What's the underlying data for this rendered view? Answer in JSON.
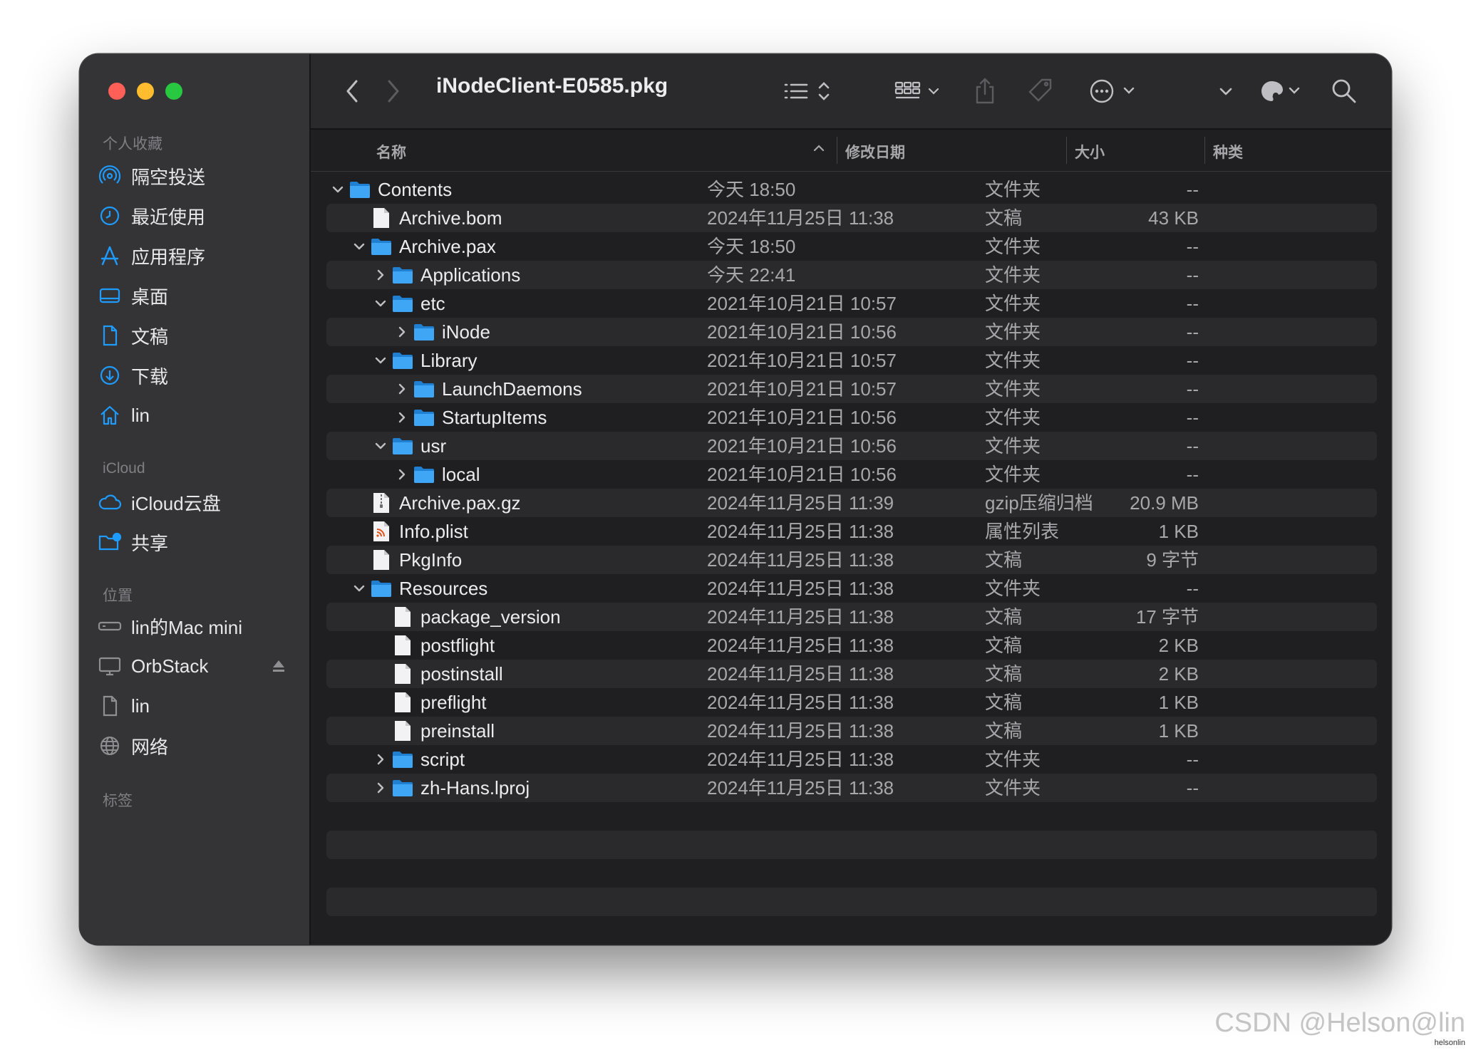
{
  "window": {
    "title": "iNodeClient-E0585.pkg"
  },
  "sidebar": {
    "sections": [
      {
        "heading": "个人收藏",
        "items": [
          {
            "label": "隔空投送",
            "icon": "airdrop-icon"
          },
          {
            "label": "最近使用",
            "icon": "clock-icon"
          },
          {
            "label": "应用程序",
            "icon": "applications-icon"
          },
          {
            "label": "桌面",
            "icon": "desktop-icon"
          },
          {
            "label": "文稿",
            "icon": "document-icon"
          },
          {
            "label": "下载",
            "icon": "download-icon"
          },
          {
            "label": "lin",
            "icon": "home-icon"
          }
        ]
      },
      {
        "heading": "iCloud",
        "items": [
          {
            "label": "iCloud云盘",
            "icon": "cloud-icon"
          },
          {
            "label": "共享",
            "icon": "shared-folder-icon"
          }
        ]
      },
      {
        "heading": "位置",
        "items": [
          {
            "label": "lin的Mac mini",
            "icon": "mac-mini-icon"
          },
          {
            "label": "OrbStack",
            "icon": "monitor-icon"
          },
          {
            "label": "lin",
            "icon": "document-icon"
          },
          {
            "label": "网络",
            "icon": "network-globe-icon"
          }
        ]
      },
      {
        "heading": "标签",
        "items": []
      }
    ]
  },
  "columns": {
    "name": "名称",
    "date": "修改日期",
    "size": "大小",
    "kind": "种类"
  },
  "files": [
    {
      "name": "Contents",
      "date": "今天 18:50",
      "size": "--",
      "kind": "文件夹",
      "level": 0,
      "type": "folder",
      "expanded": true
    },
    {
      "name": "Archive.bom",
      "date": "2024年11月25日 11:38",
      "size": "43 KB",
      "kind": "文稿",
      "level": 1,
      "type": "file"
    },
    {
      "name": "Archive.pax",
      "date": "今天 18:50",
      "size": "--",
      "kind": "文件夹",
      "level": 1,
      "type": "folder",
      "expanded": true
    },
    {
      "name": "Applications",
      "date": "今天 22:41",
      "size": "--",
      "kind": "文件夹",
      "level": 2,
      "type": "folder",
      "expanded": false
    },
    {
      "name": "etc",
      "date": "2021年10月21日 10:57",
      "size": "--",
      "kind": "文件夹",
      "level": 2,
      "type": "folder",
      "expanded": true
    },
    {
      "name": "iNode",
      "date": "2021年10月21日 10:56",
      "size": "--",
      "kind": "文件夹",
      "level": 3,
      "type": "folder",
      "expanded": false
    },
    {
      "name": "Library",
      "date": "2021年10月21日 10:57",
      "size": "--",
      "kind": "文件夹",
      "level": 2,
      "type": "folder",
      "expanded": true
    },
    {
      "name": "LaunchDaemons",
      "date": "2021年10月21日 10:57",
      "size": "--",
      "kind": "文件夹",
      "level": 3,
      "type": "folder",
      "expanded": false
    },
    {
      "name": "StartupItems",
      "date": "2021年10月21日 10:56",
      "size": "--",
      "kind": "文件夹",
      "level": 3,
      "type": "folder",
      "expanded": false
    },
    {
      "name": "usr",
      "date": "2021年10月21日 10:56",
      "size": "--",
      "kind": "文件夹",
      "level": 2,
      "type": "folder",
      "expanded": true
    },
    {
      "name": "local",
      "date": "2021年10月21日 10:56",
      "size": "--",
      "kind": "文件夹",
      "level": 3,
      "type": "folder",
      "expanded": false
    },
    {
      "name": "Archive.pax.gz",
      "date": "2024年11月25日 11:39",
      "size": "20.9 MB",
      "kind": "gzip压缩归档",
      "level": 1,
      "type": "archive"
    },
    {
      "name": "Info.plist",
      "date": "2024年11月25日 11:38",
      "size": "1 KB",
      "kind": "属性列表",
      "level": 1,
      "type": "plist"
    },
    {
      "name": "PkgInfo",
      "date": "2024年11月25日 11:38",
      "size": "9 字节",
      "kind": "文稿",
      "level": 1,
      "type": "file"
    },
    {
      "name": "Resources",
      "date": "2024年11月25日 11:38",
      "size": "--",
      "kind": "文件夹",
      "level": 1,
      "type": "folder",
      "expanded": true
    },
    {
      "name": "package_version",
      "date": "2024年11月25日 11:38",
      "size": "17 字节",
      "kind": "文稿",
      "level": 2,
      "type": "file"
    },
    {
      "name": "postflight",
      "date": "2024年11月25日 11:38",
      "size": "2 KB",
      "kind": "文稿",
      "level": 2,
      "type": "file"
    },
    {
      "name": "postinstall",
      "date": "2024年11月25日 11:38",
      "size": "2 KB",
      "kind": "文稿",
      "level": 2,
      "type": "file"
    },
    {
      "name": "preflight",
      "date": "2024年11月25日 11:38",
      "size": "1 KB",
      "kind": "文稿",
      "level": 2,
      "type": "file"
    },
    {
      "name": "preinstall",
      "date": "2024年11月25日 11:38",
      "size": "1 KB",
      "kind": "文稿",
      "level": 2,
      "type": "file"
    },
    {
      "name": "script",
      "date": "2024年11月25日 11:38",
      "size": "--",
      "kind": "文件夹",
      "level": 2,
      "type": "folder",
      "expanded": false
    },
    {
      "name": "zh-Hans.lproj",
      "date": "2024年11月25日 11:38",
      "size": "--",
      "kind": "文件夹",
      "level": 2,
      "type": "folder",
      "expanded": false
    }
  ],
  "watermark": "CSDN @Helson@lin",
  "watermark_small": "helsonlin",
  "colors": {
    "accent": "#1e9bff",
    "folder": "#3ea6f5",
    "sidebar_bg": "#343437",
    "main_bg": "#1f1f21"
  }
}
